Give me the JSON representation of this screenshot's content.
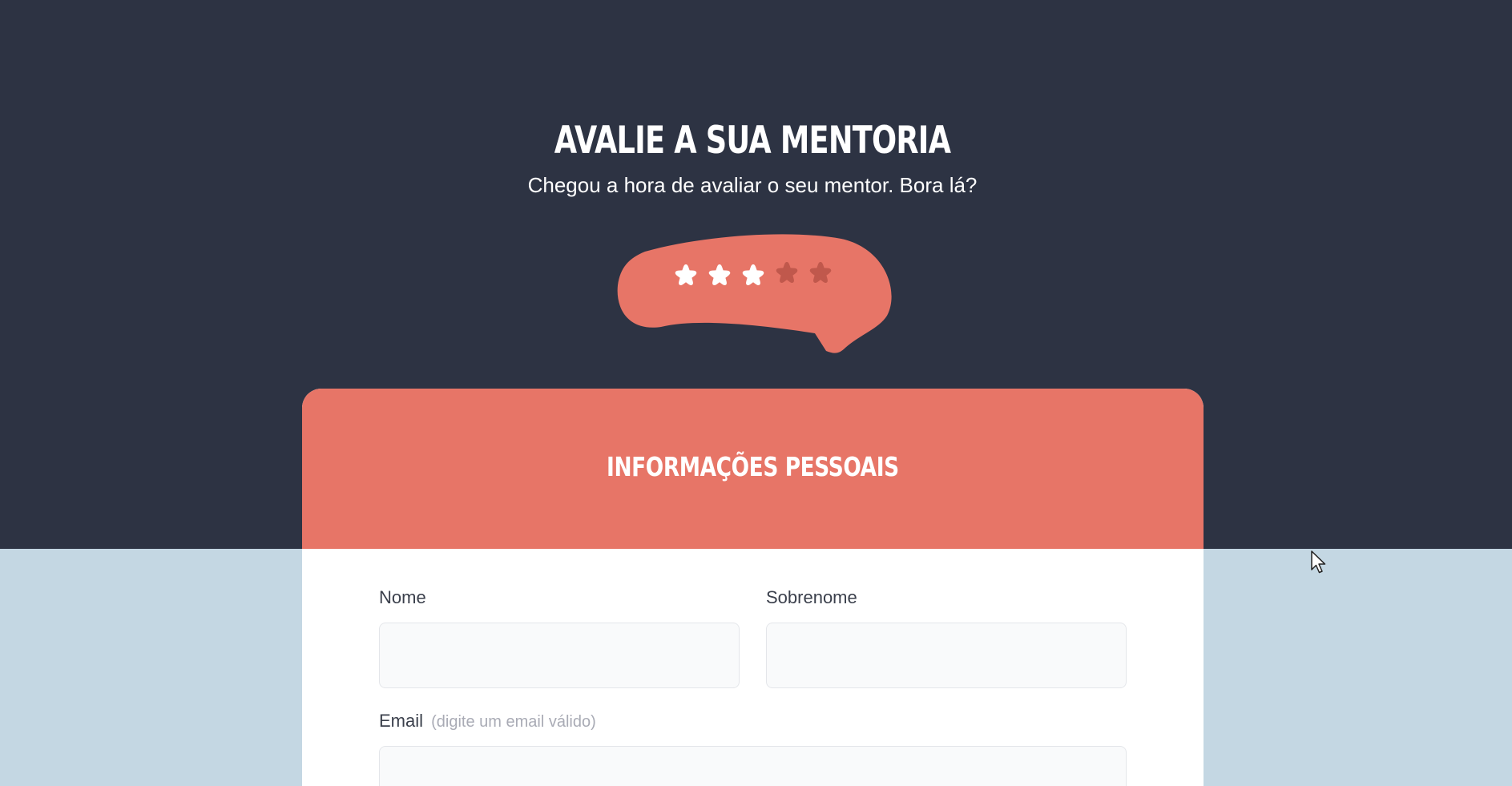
{
  "hero": {
    "title": "Avalie a sua mentoria",
    "subtitle": "Chegou a hora de avaliar o seu mentor. Bora lá?"
  },
  "rating": {
    "value": 3,
    "max": 5,
    "stars": [
      "star-icon",
      "star-icon",
      "star-icon",
      "star-icon",
      "star-icon"
    ]
  },
  "form": {
    "section_title": "Informações pessoais",
    "first_name": {
      "label": "Nome",
      "value": "",
      "placeholder": ""
    },
    "last_name": {
      "label": "Sobrenome",
      "value": "",
      "placeholder": ""
    },
    "email": {
      "label": "Email",
      "hint": "(digite um email válido)",
      "value": "",
      "placeholder": ""
    }
  },
  "colors": {
    "dark_background": "#2d3343",
    "light_background": "#c4d7e3",
    "accent": "#e77567",
    "star_active": "#ffffff",
    "star_inactive": "#c0584c",
    "input_background": "#f9fafb"
  },
  "icons": {
    "cursor": "arrow-cursor-icon"
  }
}
